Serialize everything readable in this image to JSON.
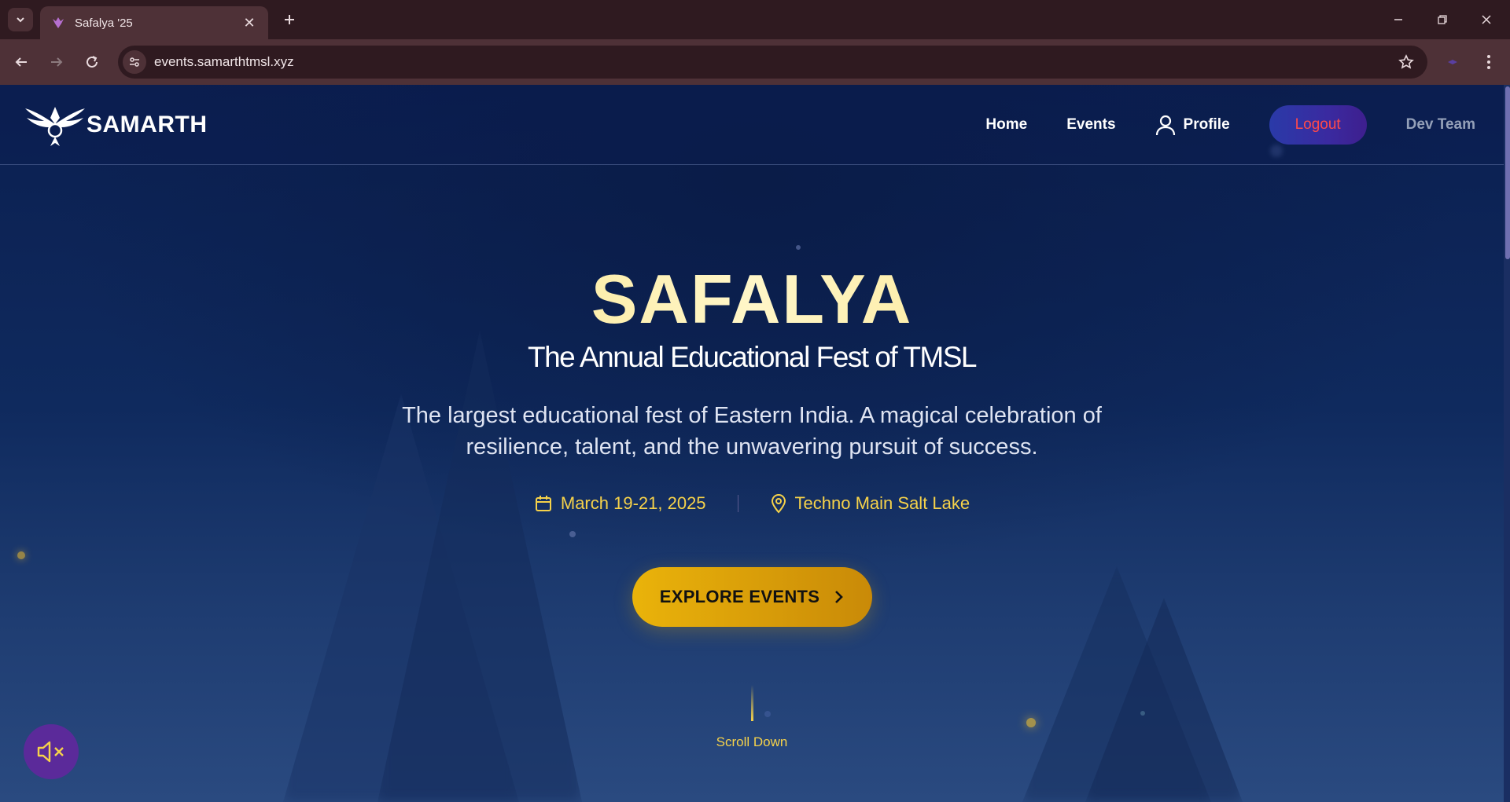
{
  "browser": {
    "tab_title": "Safalya '25",
    "url": "events.samarthtmsl.xyz"
  },
  "navbar": {
    "brand": "SAMARTH",
    "links": {
      "home": "Home",
      "events": "Events",
      "profile": "Profile",
      "logout": "Logout",
      "dev_team": "Dev Team"
    }
  },
  "hero": {
    "title": "SAFALYA",
    "subtitle": "The Annual Educational Fest of TMSL",
    "description": "The largest educational fest of Eastern India. A magical celebration of resilience, talent, and the unwavering pursuit of success.",
    "date": "March 19-21, 2025",
    "venue": "Techno Main Salt Lake",
    "cta_label": "EXPLORE EVENTS",
    "scroll_label": "Scroll Down"
  },
  "icons": {
    "tab_list": "chevron-down-icon",
    "favicon": "phoenix-favicon-icon",
    "close": "close-icon",
    "new_tab": "plus-icon",
    "back": "back-arrow-icon",
    "forward": "forward-arrow-icon",
    "reload": "reload-icon",
    "site_info": "tune-icon",
    "bookmark": "star-icon",
    "menu": "kebab-menu-icon",
    "profile": "user-icon",
    "calendar": "calendar-icon",
    "location": "map-pin-icon",
    "cta_arrow": "chevron-right-icon",
    "mute": "volume-muted-icon"
  },
  "colors": {
    "accent_gold": "#f6d24a",
    "logout_text": "#ff4a4a",
    "page_bg": "#0b1f4e",
    "chrome_bg": "#2f1a20",
    "mute_button": "#5b2a9a"
  }
}
